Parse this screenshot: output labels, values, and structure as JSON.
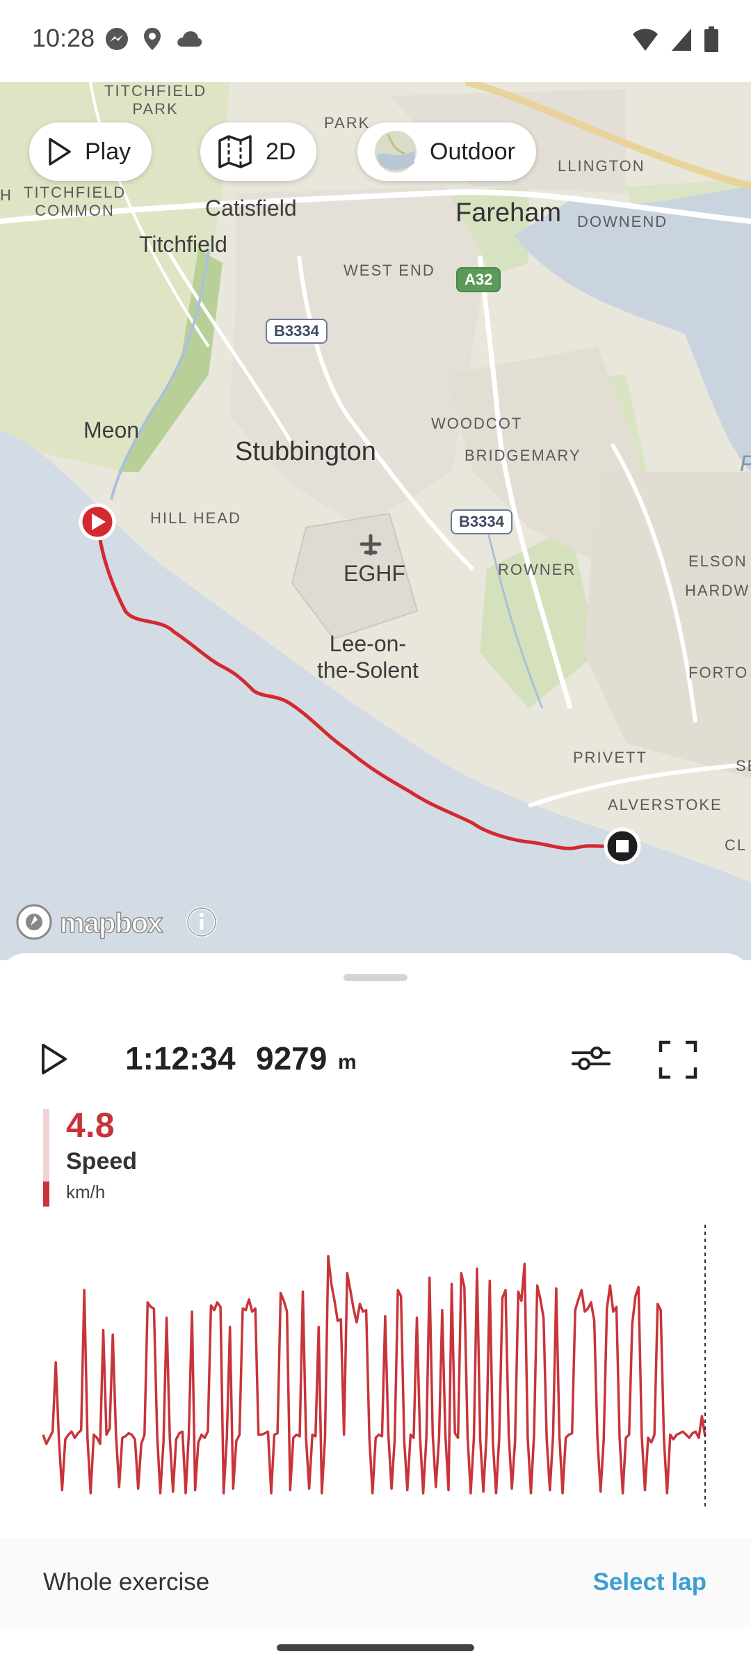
{
  "status_bar": {
    "time": "10:28",
    "left_icons": [
      "messenger-icon",
      "location-icon",
      "cloud-icon"
    ],
    "right_icons": [
      "wifi-icon",
      "signal-icon",
      "battery-icon"
    ]
  },
  "map": {
    "chips": {
      "play": "Play",
      "view": "2D",
      "style": "Outdoor"
    },
    "places": {
      "titchfield_park": "TITCHFIELD\nPARK",
      "titchfield_common": "TITCHFIELD\nCOMMON",
      "catisfield": "Catisfield",
      "titchfield": "Titchfield",
      "fareham": "Fareham",
      "downend": "DOWNEND",
      "west_end": "WEST END",
      "meon": "Meon",
      "stubbington": "Stubbington",
      "woodcot": "WOODCOT",
      "bridgemary": "BRIDGEMARY",
      "hill_head": "HILL HEAD",
      "egfh": "EGHF",
      "rowner": "ROWNER",
      "elson": "ELSON",
      "hardw": "HARDW",
      "lee": "Lee-on-\nthe-Solent",
      "forto": "FORTO",
      "privett": "PRIVETT",
      "alverstoke": "ALVERSTOKE",
      "llington": "LLINGTON",
      "park": "PARK",
      "cl": "CL",
      "se": "SE",
      "h": "H",
      "p": "P"
    },
    "roads": {
      "a32": "A32",
      "b3334_1": "B3334",
      "b3334_2": "B3334"
    },
    "attribution": "mapbox",
    "colors": {
      "route": "#d3292f",
      "water": "#d3dbe5",
      "land": "#e9e7dc"
    }
  },
  "playback": {
    "duration": "1:12:34",
    "distance": "9279",
    "distance_unit": "m"
  },
  "metric": {
    "value": "4.8",
    "name": "Speed",
    "unit": "km/h",
    "color": "#c8343a",
    "level": 0.26
  },
  "chart_data": {
    "type": "line",
    "title": "Speed",
    "ylabel": "km/h",
    "series": [
      {
        "name": "Speed",
        "values": [
          4.8,
          4.2,
          4.6,
          5.0,
          9.5,
          4.4,
          1.2,
          4.5,
          4.8,
          5.0,
          4.6,
          4.9,
          5.1,
          14.2,
          4.6,
          1.0,
          4.8,
          4.6,
          4.2,
          11.6,
          4.8,
          5.2,
          11.3,
          4.8,
          1.4,
          4.6,
          4.7,
          4.9,
          4.8,
          4.5,
          1.3,
          4.2,
          4.8,
          13.4,
          13.1,
          13.0,
          4.8,
          1.0,
          4.3,
          12.4,
          4.6,
          1.1,
          4.5,
          4.9,
          5.0,
          1.0,
          4.8,
          12.8,
          1.2,
          4.3,
          4.8,
          4.6,
          5.0,
          13.2,
          12.9,
          13.4,
          13.1,
          1.0,
          4.6,
          11.8,
          1.3,
          4.4,
          4.8,
          13.0,
          12.9,
          13.6,
          12.8,
          13.0,
          4.8,
          4.8,
          4.9,
          5.0,
          1.0,
          4.8,
          4.9,
          14.0,
          13.5,
          12.8,
          1.2,
          4.6,
          4.8,
          4.7,
          14.1,
          4.6,
          1.3,
          4.8,
          4.7,
          11.8,
          1.0,
          4.6,
          16.4,
          14.6,
          13.5,
          12.2,
          12.3,
          4.8,
          15.3,
          14.2,
          13.0,
          12.1,
          13.3,
          12.8,
          12.9,
          4.6,
          1.0,
          4.6,
          4.8,
          4.7,
          12.5,
          4.8,
          1.3,
          4.5,
          14.2,
          13.8,
          4.4,
          1.2,
          4.8,
          4.6,
          12.4,
          4.7,
          1.0,
          4.6,
          15.0,
          4.8,
          1.4,
          4.6,
          12.9,
          4.8,
          1.2,
          14.6,
          4.9,
          4.6,
          15.3,
          14.4,
          4.7,
          1.0,
          4.6,
          15.6,
          4.5,
          1.1,
          4.8,
          14.8,
          4.3,
          1.0,
          4.6,
          13.7,
          14.2,
          4.8,
          1.3,
          4.4,
          14.1,
          13.5,
          15.9,
          4.6,
          1.0,
          4.8,
          14.5,
          13.6,
          12.4,
          4.5,
          1.2,
          4.8,
          14.3,
          4.7,
          1.0,
          4.6,
          4.8,
          4.9,
          12.9,
          13.6,
          14.2,
          12.8,
          13.0,
          13.4,
          12.2,
          4.6,
          1.1,
          4.5,
          13.0,
          14.5,
          12.8,
          13.1,
          4.6,
          1.0,
          4.6,
          4.8,
          12.0,
          13.8,
          14.4,
          4.7,
          1.2,
          4.6,
          4.3,
          4.8,
          13.3,
          12.9,
          4.5,
          1.0,
          4.8,
          4.5,
          4.8,
          4.9,
          5.0,
          4.8,
          4.6,
          4.9,
          5.0,
          4.6,
          6.0,
          4.7
        ]
      }
    ],
    "ylim": [
      0,
      18
    ],
    "grid": false,
    "legend": "none",
    "playhead": "end"
  },
  "footer": {
    "label": "Whole exercise",
    "link": "Select lap"
  }
}
